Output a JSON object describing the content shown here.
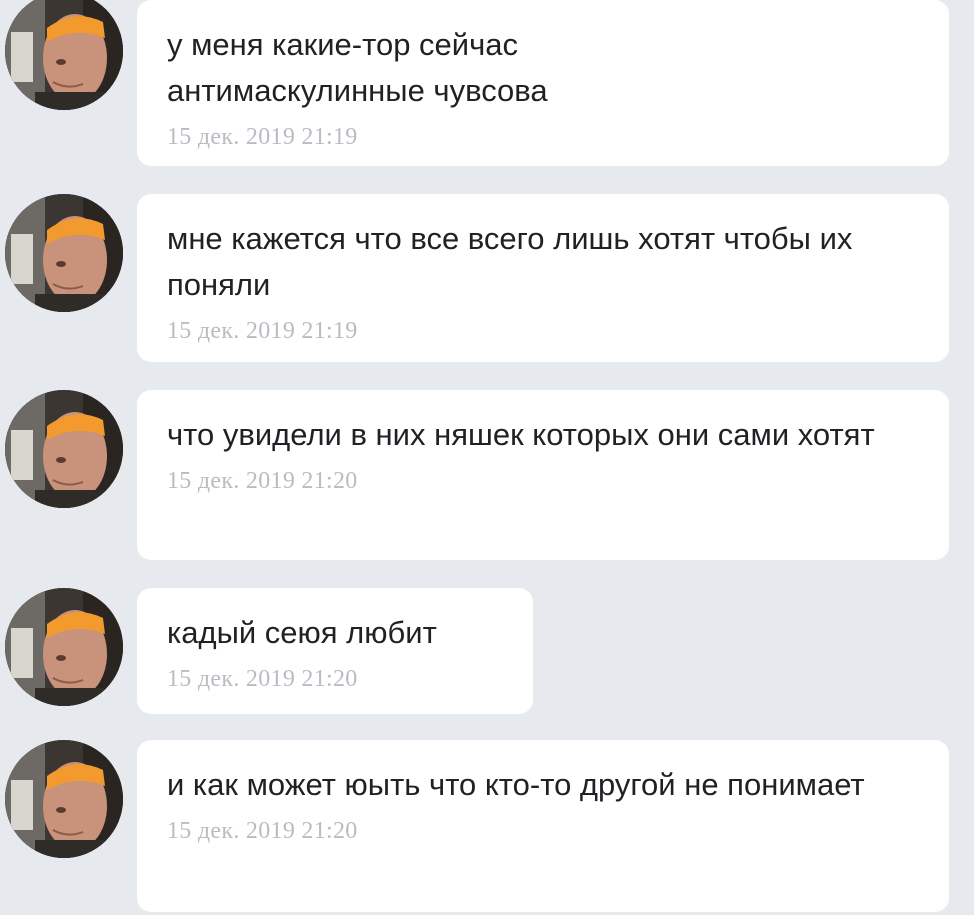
{
  "messages": [
    {
      "text": "у меня какие-тор сейчас антимаскулинные чувсова",
      "time": "15 дек. 2019 21:19"
    },
    {
      "text": "мне кажется что все всего лишь хотят чтобы их поняли",
      "time": "15 дек. 2019 21:19"
    },
    {
      "text": "что увидели в них няшек которых они сами хотят",
      "time": "15 дек. 2019 21:20"
    },
    {
      "text": "кадый сеюя любит",
      "time": "15 дек. 2019 21:20"
    },
    {
      "text": "и как может юыть что кто-то другой не понимает",
      "time": "15 дек. 2019 21:20"
    }
  ],
  "colors": {
    "background": "#e6e9ee",
    "bubble": "#ffffff",
    "text": "#1f2124",
    "timestamp": "#b9bcc2",
    "headband": "#f29a2e"
  },
  "icons": {
    "avatar": "user-photo-avatar"
  }
}
